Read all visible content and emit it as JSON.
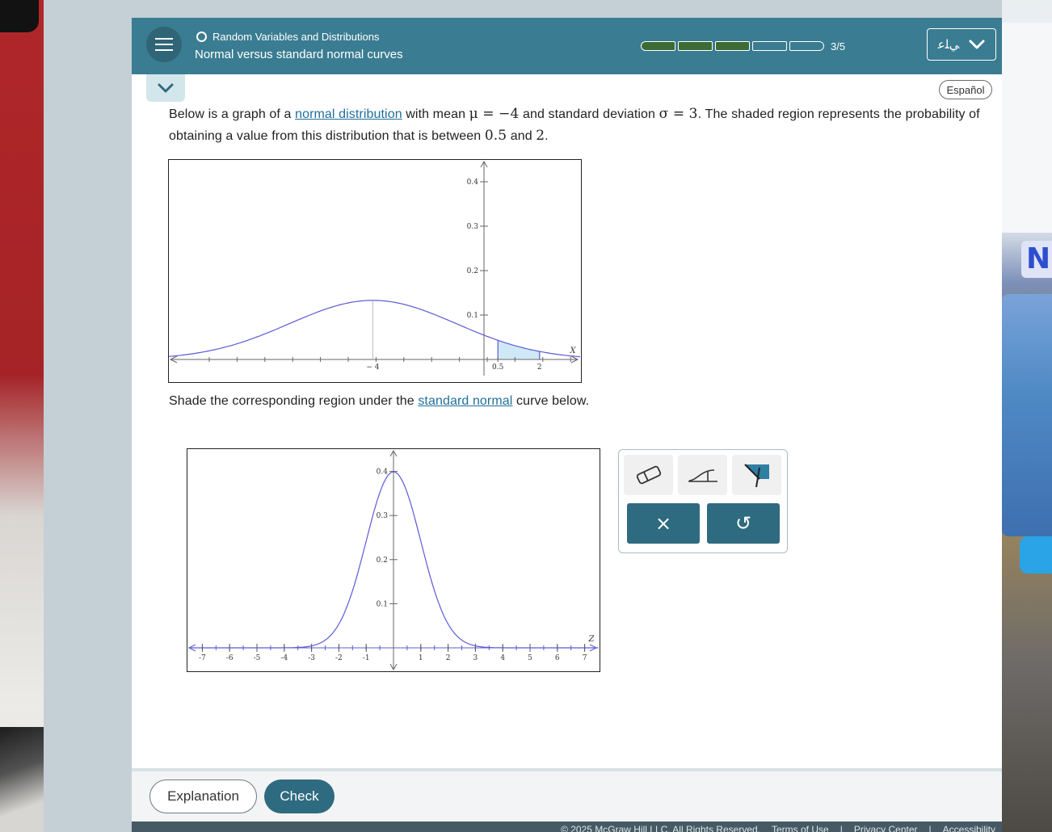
{
  "header": {
    "topic": "Random Variables and Distributions",
    "title": "Normal versus standard normal curves",
    "progress_text": "3/5",
    "progress_done": 3,
    "progress_total": 5,
    "user_name": "ﻲﻠﻋ",
    "menu_icon": "hamburger-icon"
  },
  "language_button": "Español",
  "problem": {
    "intro_1": "Below is a graph of a ",
    "link_normal": "normal distribution",
    "intro_2": " with mean ",
    "mean_expr": "μ = −4",
    "intro_3": " and standard deviation ",
    "sd_expr": "σ = 3",
    "intro_4": ". The shaded region represents the probability of obtaining a value from this distribution that is between ",
    "low": "0.5",
    "intro_5": " and ",
    "high": "2",
    "intro_6": "."
  },
  "prompt": {
    "text_1": "Shade the corresponding region under the ",
    "link_standard": "standard normal",
    "text_2": " curve below."
  },
  "chart_data": [
    {
      "type": "line",
      "series": [
        {
          "distribution": "normal",
          "mean": -4,
          "sd": 3
        }
      ],
      "xlabel": "X",
      "x_tick_labels": [
        "− 4",
        "0.5",
        "2"
      ],
      "y_ticks": [
        0.1,
        0.2,
        0.3,
        0.4
      ],
      "y_tick_labels": [
        "0.1",
        "0.2",
        "0.3",
        "0.4"
      ],
      "shaded_region": [
        0.5,
        2
      ],
      "colors": {
        "curve": "#5b5bd6",
        "shade": "#cfe8f5"
      }
    },
    {
      "type": "line",
      "series": [
        {
          "distribution": "normal",
          "mean": 0,
          "sd": 1
        }
      ],
      "xlabel": "Z",
      "xlim": [
        -7.5,
        7.5
      ],
      "x_ticks": [
        -7,
        -6,
        -5,
        -4,
        -3,
        -2,
        -1,
        1,
        2,
        3,
        4,
        5,
        6,
        7
      ],
      "x_tick_labels": [
        "-7",
        "-6",
        "-5",
        "-4",
        "-3",
        "-2",
        "-1",
        "1",
        "2",
        "3",
        "4",
        "5",
        "6",
        "7"
      ],
      "y_ticks": [
        0.1,
        0.2,
        0.3,
        0.4
      ],
      "y_tick_labels": [
        "0.1",
        "0.2",
        "0.3",
        "0.4"
      ],
      "colors": {
        "curve": "#5b5bd6"
      }
    }
  ],
  "tools": {
    "eraser_icon": "eraser-icon",
    "left_shade_icon": "shade-left-icon",
    "region_icon": "shade-region-icon",
    "clear_label": "×",
    "undo_label": "↺"
  },
  "footer": {
    "explanation": "Explanation",
    "check": "Check",
    "copyright": "© 2025 McGraw Hill LLC. All Rights Reserved.",
    "terms": "Terms of Use",
    "sep": "|",
    "privacy": "Privacy Center",
    "accessibility": "Accessibility"
  }
}
